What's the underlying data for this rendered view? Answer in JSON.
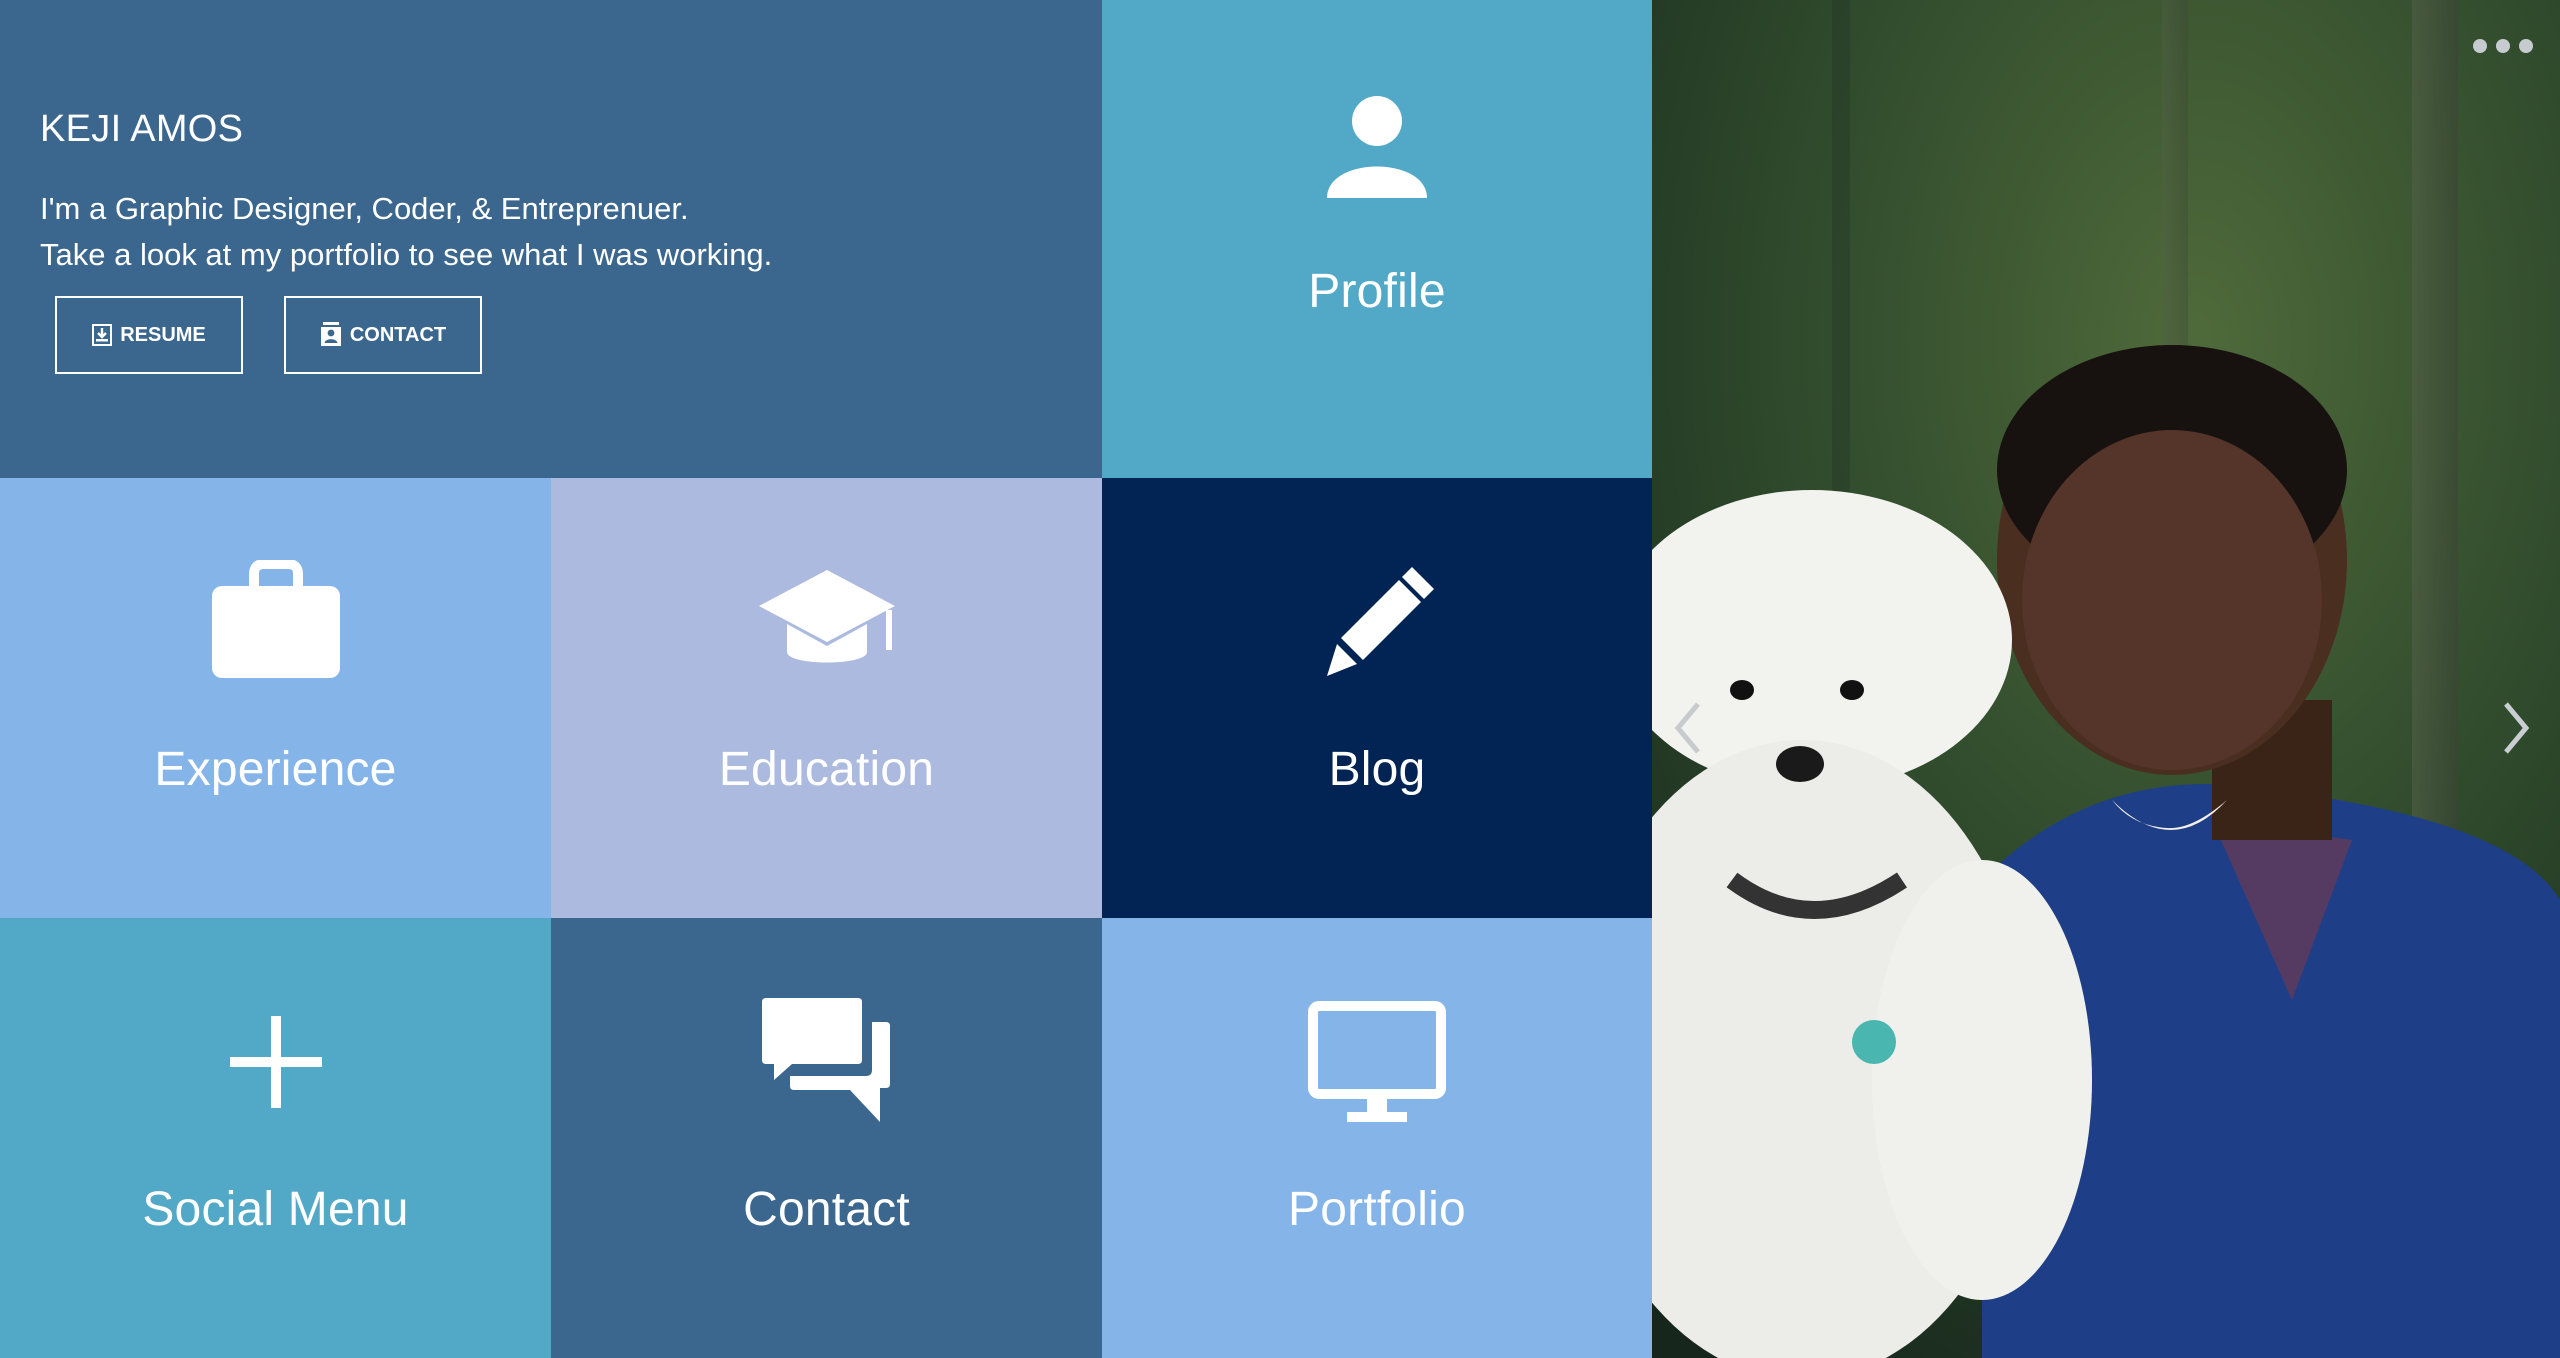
{
  "intro": {
    "name": "KEJI AMOS",
    "bio_line1": "I'm a Graphic Designer, Coder, & Entreprenuer.",
    "bio_line2": "Take a look at my portfolio to see what I was working.",
    "resume_label": "RESUME",
    "contact_label": "CONTACT"
  },
  "tiles": {
    "profile": "Profile",
    "experience": "Experience",
    "education": "Education",
    "blog": "Blog",
    "social": "Social Menu",
    "contact": "Contact",
    "portfolio": "Portfolio"
  },
  "colors": {
    "steel_blue": "#3b668e",
    "teal": "#52a8c7",
    "light_blue": "#85b4e9",
    "lavender": "#abbade",
    "navy": "#022455"
  },
  "icons": [
    "user-icon",
    "briefcase-icon",
    "graduation-cap-icon",
    "pencil-icon",
    "plus-icon",
    "chat-bubbles-icon",
    "monitor-icon",
    "download-icon",
    "contact-card-icon",
    "chevron-left-icon",
    "chevron-right-icon",
    "more-dots-icon"
  ]
}
